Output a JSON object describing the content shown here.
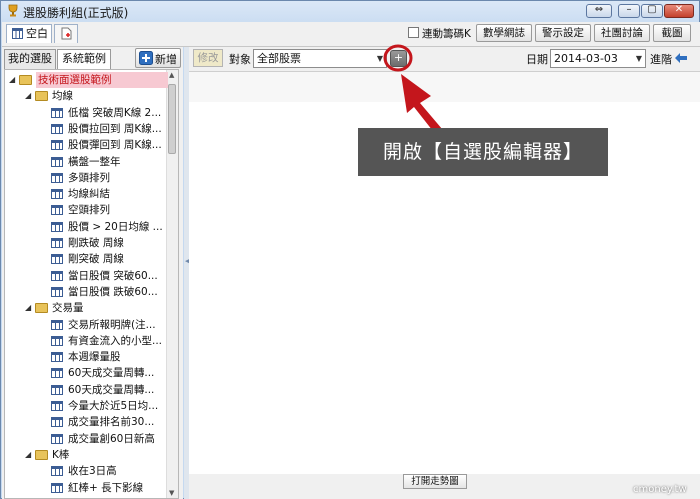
{
  "window": {
    "title": "選股勝利組(正式版)",
    "controls": [
      "⇔",
      "–",
      "▢",
      "✕"
    ]
  },
  "toolbar": {
    "tabs": [
      "空白",
      ""
    ],
    "sync_checkbox_label": "連動籌碼K",
    "buttons": [
      "數學網誌",
      "警示設定",
      "社團討論",
      "截圖"
    ]
  },
  "left_panel": {
    "tabs": [
      "我的選股",
      "系統範例"
    ],
    "add_button": "新增",
    "tree": [
      {
        "type": "folder",
        "level": 0,
        "label": "技術面選股範例",
        "selected": true
      },
      {
        "type": "folder",
        "level": 1,
        "label": "均線"
      },
      {
        "type": "item",
        "level": 2,
        "label": "低檔 突破周K線 2..."
      },
      {
        "type": "item",
        "level": 2,
        "label": "股價拉回到 周K線..."
      },
      {
        "type": "item",
        "level": 2,
        "label": "股價彈回到 周K線..."
      },
      {
        "type": "item",
        "level": 2,
        "label": "橫盤一整年"
      },
      {
        "type": "item",
        "level": 2,
        "label": "多頭排列"
      },
      {
        "type": "item",
        "level": 2,
        "label": "均線糾結"
      },
      {
        "type": "item",
        "level": 2,
        "label": "空頭排列"
      },
      {
        "type": "item",
        "level": 2,
        "label": "股價 > 20日均線 ..."
      },
      {
        "type": "item",
        "level": 2,
        "label": "剛跌破 周線"
      },
      {
        "type": "item",
        "level": 2,
        "label": "剛突破 周線"
      },
      {
        "type": "item",
        "level": 2,
        "label": "當日股價 突破60..."
      },
      {
        "type": "item",
        "level": 2,
        "label": "當日股價 跌破60..."
      },
      {
        "type": "folder",
        "level": 1,
        "label": "交易量"
      },
      {
        "type": "item",
        "level": 2,
        "label": "交易所報明牌(注..."
      },
      {
        "type": "item",
        "level": 2,
        "label": "有資金流入的小型..."
      },
      {
        "type": "item",
        "level": 2,
        "label": "本週爆量股"
      },
      {
        "type": "item",
        "level": 2,
        "label": "60天成交量周轉..."
      },
      {
        "type": "item",
        "level": 2,
        "label": "60天成交量周轉..."
      },
      {
        "type": "item",
        "level": 2,
        "label": "今量大於近5日均..."
      },
      {
        "type": "item",
        "level": 2,
        "label": "成交量排名前30..."
      },
      {
        "type": "item",
        "level": 2,
        "label": "成交量創60日新高"
      },
      {
        "type": "folder",
        "level": 1,
        "label": "K棒"
      },
      {
        "type": "item",
        "level": 2,
        "label": "收在3日高"
      },
      {
        "type": "item",
        "level": 2,
        "label": "紅棒+ 長下影線"
      }
    ]
  },
  "right_panel": {
    "edit_button": "修改",
    "target_label": "對象",
    "target_value": "全部股票",
    "plus_button": "+",
    "date_label": "日期",
    "date_value": "2014-03-03",
    "advanced_label": "進階",
    "open_trend_button": "打開走勢圖"
  },
  "annotation": {
    "callout_text": "開啟【自選股編輯器】",
    "color_callout_bg": "#555555",
    "color_arrow": "#c4161c"
  },
  "watermark": "cmoney.tw"
}
